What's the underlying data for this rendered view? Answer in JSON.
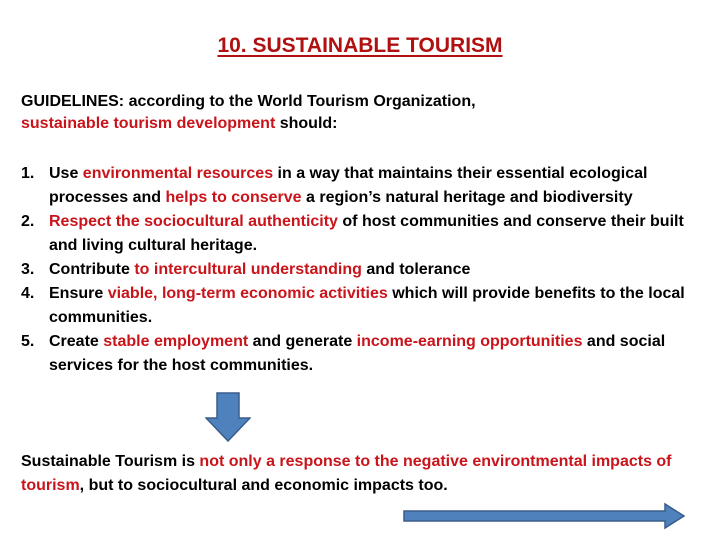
{
  "title": "10. SUSTAINABLE TOURISM",
  "guidelines": {
    "line1": "GUIDELINES: according to the World Tourism Organization,",
    "line2_red": "sustainable tourism development",
    "line2_rest": " should:"
  },
  "items": [
    {
      "num": "1.",
      "parts": [
        "Use ",
        "environmental resources",
        " in a way that maintains their essential ecological processes and ",
        "helps to conserve",
        " a region’s natural heritage and biodiversity"
      ]
    },
    {
      "num": "2.",
      "parts": [
        "Respect the sociocultural authenticity",
        " of host communities and conserve their built and living cultural heritage."
      ]
    },
    {
      "num": "3.",
      "parts": [
        "Contribute ",
        "to intercultural understanding",
        " and tolerance"
      ]
    },
    {
      "num": "4.",
      "parts": [
        "Ensure ",
        "viable, long-term economic activities",
        " which will provide benefits to the local communities."
      ]
    },
    {
      "num": "5.",
      "parts": [
        "Create ",
        "stable employment",
        "  and generate ",
        "income-earning opportunities",
        " and social services for the host communities."
      ]
    }
  ],
  "closing": {
    "p1": "Sustainable Tourism is ",
    "p2_red": "not only a response to the negative environtmental  impacts of tourism",
    "p3": ", but to sociocultural and economic impacts too."
  },
  "colors": {
    "accent_red": "#c8141a",
    "arrow_blue": "#4f81bd"
  },
  "icons": {
    "down_arrow": "down-arrow-icon",
    "right_arrow": "right-arrow-icon"
  }
}
